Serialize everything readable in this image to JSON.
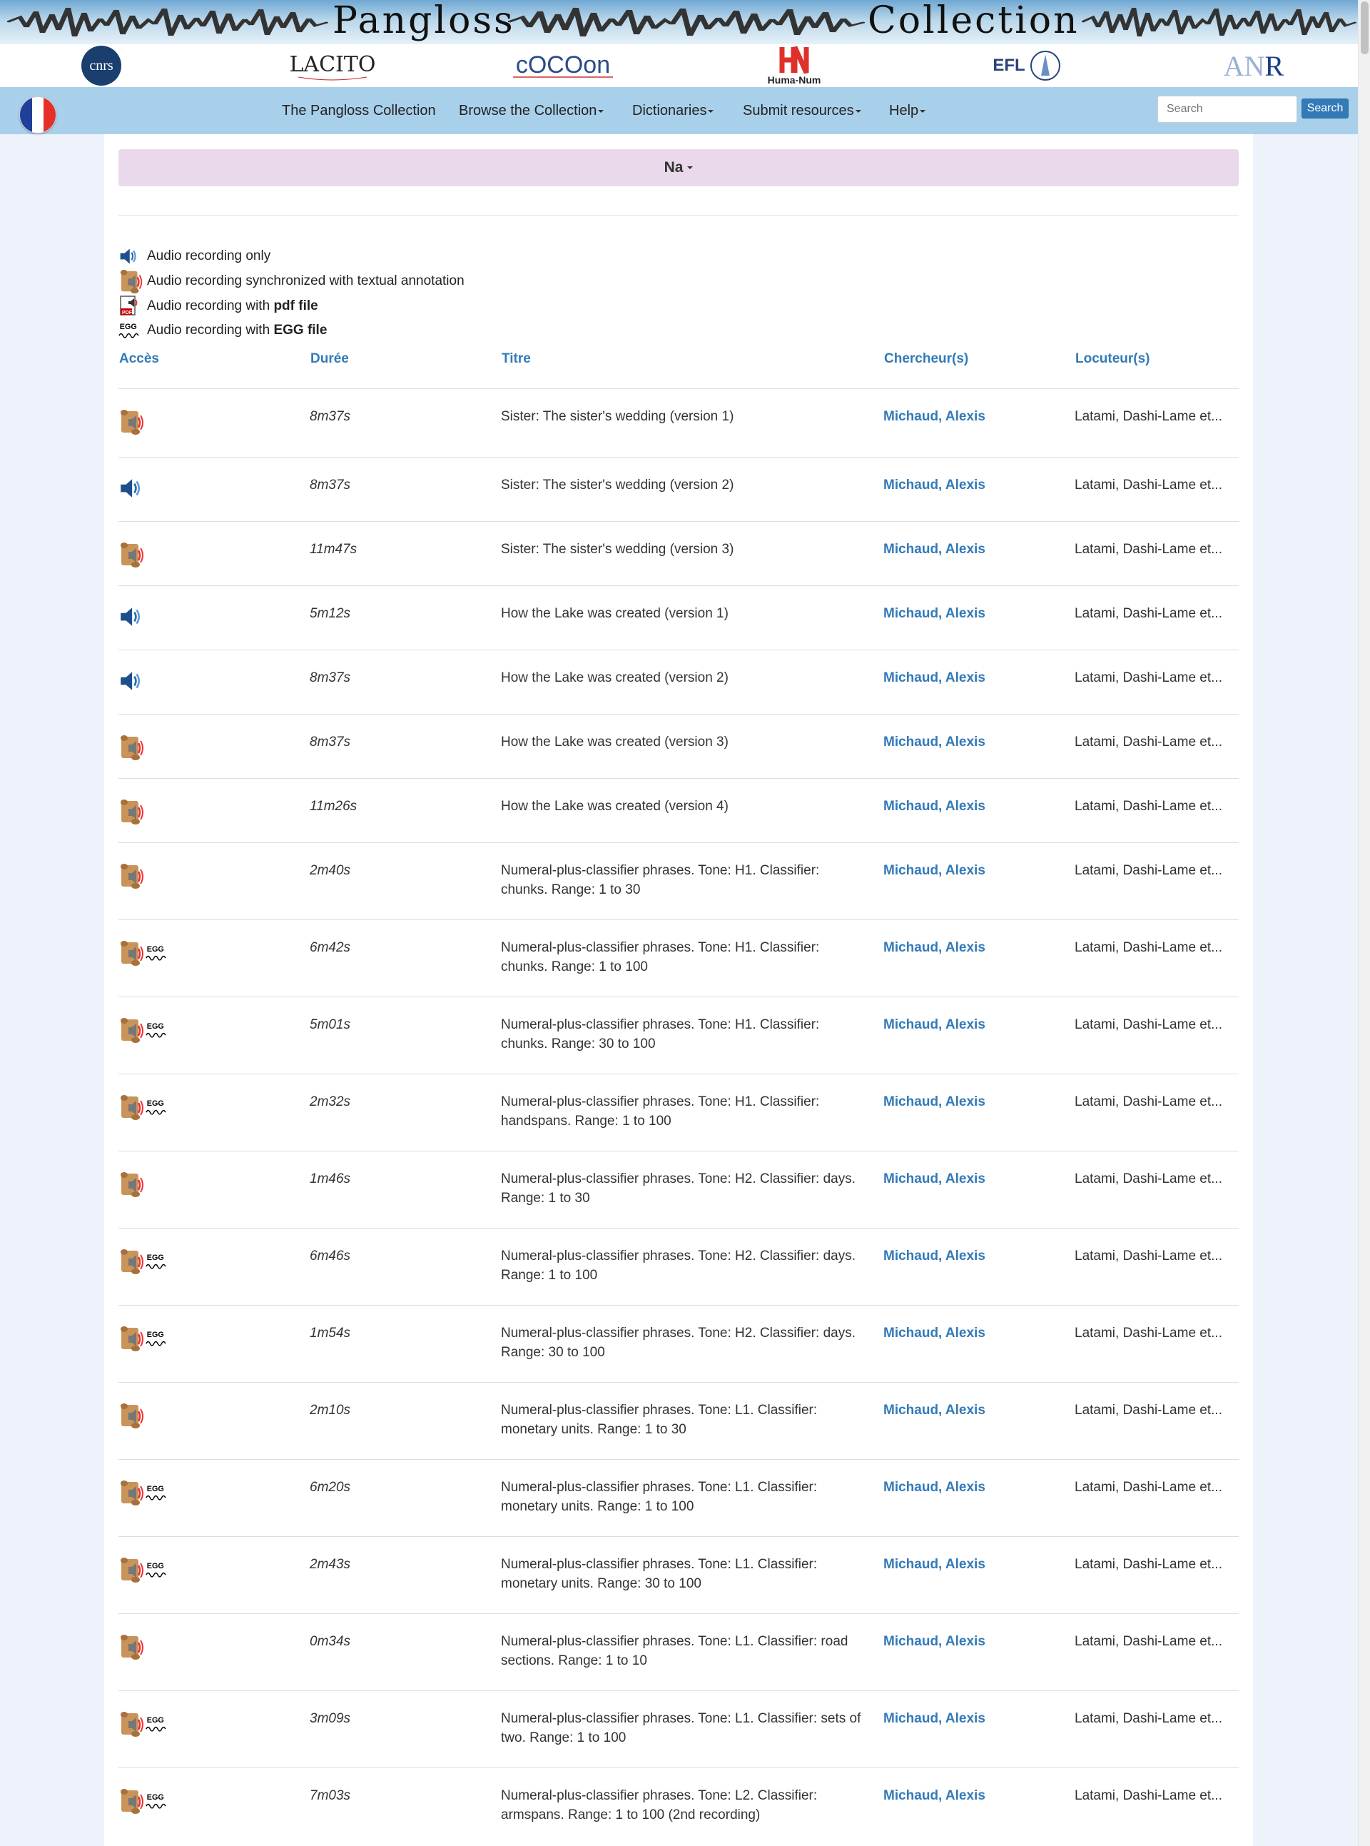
{
  "banner": {
    "title_left": "Pangloss",
    "title_right": "Collection"
  },
  "logos": [
    "cnrs",
    "LACITO",
    "COCOON",
    "Huma-Num",
    "EFL",
    "ANR"
  ],
  "logo_caption_huma": "Huma-Num",
  "logo_caption_efl": "EFL",
  "logo_caption_anr_a": "AN",
  "logo_caption_anr_r": "R",
  "logo_caption_cnrs": "cnrs",
  "logo_caption_lacito": "LACITO",
  "logo_caption_cocoon": "cOCOon",
  "nav": {
    "items": [
      "The Pangloss Collection",
      "Browse the Collection",
      "Dictionaries",
      "Submit resources",
      "Help"
    ],
    "search_placeholder": "Search",
    "search_button": "Search",
    "flag_colors": [
      "#1f3f9a",
      "#ffffff",
      "#e5302a"
    ]
  },
  "language": {
    "label": "Na"
  },
  "legend": {
    "audio_only": "Audio recording only",
    "audio_sync": "Audio recording synchronized with textual annotation",
    "audio_pdf_prefix": "Audio recording with ",
    "audio_pdf_bold": "pdf file",
    "audio_egg_prefix": "Audio recording with ",
    "audio_egg_bold": "EGG file"
  },
  "table": {
    "headers": {
      "access": "Accès",
      "duration": "Durée",
      "title": "Titre",
      "researchers": "Chercheur(s)",
      "speakers": "Locuteur(s)"
    },
    "rows": [
      {
        "icon": "annotated",
        "duration": "8m37s",
        "title": "Sister: The sister's wedding (version 1)",
        "researcher": "Michaud, Alexis",
        "speakers": "Latami, Dashi-Lame et..."
      },
      {
        "icon": "audio",
        "duration": "8m37s",
        "title": "Sister: The sister's wedding (version 2)",
        "researcher": "Michaud, Alexis",
        "speakers": "Latami, Dashi-Lame et..."
      },
      {
        "icon": "annotated",
        "duration": "11m47s",
        "title": "Sister: The sister's wedding (version 3)",
        "researcher": "Michaud, Alexis",
        "speakers": "Latami, Dashi-Lame et..."
      },
      {
        "icon": "audio",
        "duration": "5m12s",
        "title": "How the Lake was created (version 1)",
        "researcher": "Michaud, Alexis",
        "speakers": "Latami, Dashi-Lame et..."
      },
      {
        "icon": "audio",
        "duration": "8m37s",
        "title": "How the Lake was created (version 2)",
        "researcher": "Michaud, Alexis",
        "speakers": "Latami, Dashi-Lame et..."
      },
      {
        "icon": "annotated",
        "duration": "8m37s",
        "title": "How the Lake was created (version 3)",
        "researcher": "Michaud, Alexis",
        "speakers": "Latami, Dashi-Lame et..."
      },
      {
        "icon": "annotated",
        "duration": "11m26s",
        "title": "How the Lake was created (version 4)",
        "researcher": "Michaud, Alexis",
        "speakers": "Latami, Dashi-Lame et..."
      },
      {
        "icon": "annotated",
        "duration": "2m40s",
        "title": "Numeral-plus-classifier phrases. Tone: H1. Classifier: chunks. Range: 1 to 30",
        "researcher": "Michaud, Alexis",
        "speakers": "Latami, Dashi-Lame et..."
      },
      {
        "icon": "annotated-egg",
        "duration": "6m42s",
        "title": "Numeral-plus-classifier phrases. Tone: H1. Classifier: chunks. Range: 1 to 100",
        "researcher": "Michaud, Alexis",
        "speakers": "Latami, Dashi-Lame et..."
      },
      {
        "icon": "annotated-egg",
        "duration": "5m01s",
        "title": "Numeral-plus-classifier phrases. Tone: H1. Classifier: chunks. Range: 30 to 100",
        "researcher": "Michaud, Alexis",
        "speakers": "Latami, Dashi-Lame et..."
      },
      {
        "icon": "annotated-egg",
        "duration": "2m32s",
        "title": "Numeral-plus-classifier phrases. Tone: H1. Classifier: handspans. Range: 1 to 100",
        "researcher": "Michaud, Alexis",
        "speakers": "Latami, Dashi-Lame et..."
      },
      {
        "icon": "annotated",
        "duration": "1m46s",
        "title": "Numeral-plus-classifier phrases. Tone: H2. Classifier: days. Range: 1 to 30",
        "researcher": "Michaud, Alexis",
        "speakers": "Latami, Dashi-Lame et..."
      },
      {
        "icon": "annotated-egg",
        "duration": "6m46s",
        "title": "Numeral-plus-classifier phrases. Tone: H2. Classifier: days. Range: 1 to 100",
        "researcher": "Michaud, Alexis",
        "speakers": "Latami, Dashi-Lame et..."
      },
      {
        "icon": "annotated-egg",
        "duration": "1m54s",
        "title": "Numeral-plus-classifier phrases. Tone: H2. Classifier: days. Range: 30 to 100",
        "researcher": "Michaud, Alexis",
        "speakers": "Latami, Dashi-Lame et..."
      },
      {
        "icon": "annotated",
        "duration": "2m10s",
        "title": "Numeral-plus-classifier phrases. Tone: L1. Classifier: monetary units. Range: 1 to 30",
        "researcher": "Michaud, Alexis",
        "speakers": "Latami, Dashi-Lame et..."
      },
      {
        "icon": "annotated-egg",
        "duration": "6m20s",
        "title": "Numeral-plus-classifier phrases. Tone: L1. Classifier: monetary units. Range: 1 to 100",
        "researcher": "Michaud, Alexis",
        "speakers": "Latami, Dashi-Lame et..."
      },
      {
        "icon": "annotated-egg",
        "duration": "2m43s",
        "title": "Numeral-plus-classifier phrases. Tone: L1. Classifier: monetary units. Range: 30 to 100",
        "researcher": "Michaud, Alexis",
        "speakers": "Latami, Dashi-Lame et..."
      },
      {
        "icon": "annotated",
        "duration": "0m34s",
        "title": "Numeral-plus-classifier phrases. Tone: L1. Classifier: road sections. Range: 1 to 10",
        "researcher": "Michaud, Alexis",
        "speakers": "Latami, Dashi-Lame et..."
      },
      {
        "icon": "annotated-egg",
        "duration": "3m09s",
        "title": "Numeral-plus-classifier phrases. Tone: L1. Classifier: sets of two. Range: 1 to 100",
        "researcher": "Michaud, Alexis",
        "speakers": "Latami, Dashi-Lame et..."
      },
      {
        "icon": "annotated-egg",
        "duration": "7m03s",
        "title": "Numeral-plus-classifier phrases. Tone: L2. Classifier: armspans. Range: 1 to 100 (2nd recording)",
        "researcher": "Michaud, Alexis",
        "speakers": "Latami, Dashi-Lame et..."
      }
    ]
  },
  "colors": {
    "link": "#337ab7",
    "navbar": "#a9d0ea",
    "language_bar": "#ead9ea"
  }
}
